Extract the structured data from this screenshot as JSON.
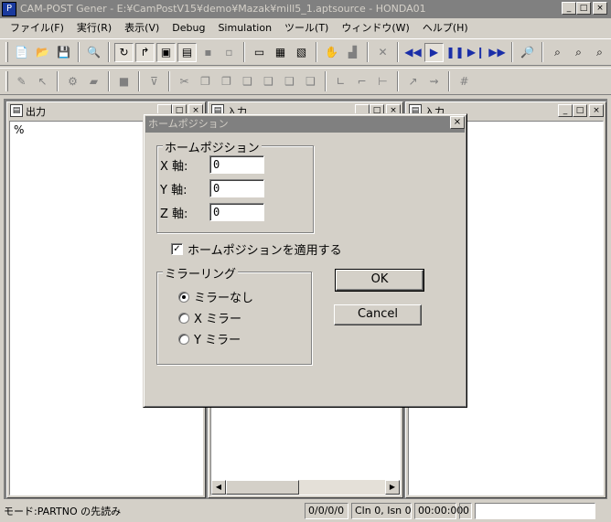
{
  "window": {
    "title": "CAM-POST Gener - E:¥CamPostV15¥demo¥Mazak¥mill5_1.aptsource - HONDA01",
    "min": "_",
    "max": "□",
    "close": "×"
  },
  "menu": [
    "ファイル(F)",
    "実行(R)",
    "表示(V)",
    "Debug",
    "Simulation",
    "ツール(T)",
    "ウィンドウ(W)",
    "ヘルプ(H)"
  ],
  "children": {
    "output": {
      "title": "出力",
      "content": "%"
    },
    "middle": {
      "title": "入力"
    },
    "right": {
      "title": "入力"
    }
  },
  "dialog": {
    "title": "ホームポジション",
    "close": "×",
    "home_group": "ホームポジション",
    "x_label": "X 軸:",
    "y_label": "Y 軸:",
    "z_label": "Z 軸:",
    "x_value": "0",
    "y_value": "0",
    "z_value": "0",
    "apply_label": "ホームポジションを適用する",
    "mirror_group": "ミラーリング",
    "mirror_options": [
      "ミラーなし",
      "X ミラー",
      "Y ミラー"
    ],
    "mirror_selected": 0,
    "ok_label": "OK",
    "cancel_label": "Cancel"
  },
  "status": {
    "message": "モード:PARTNO の先読み",
    "counts": "0/0/0/0",
    "cln": "Cln 0, Isn 0",
    "time": "00:00:00",
    "num": "0"
  }
}
